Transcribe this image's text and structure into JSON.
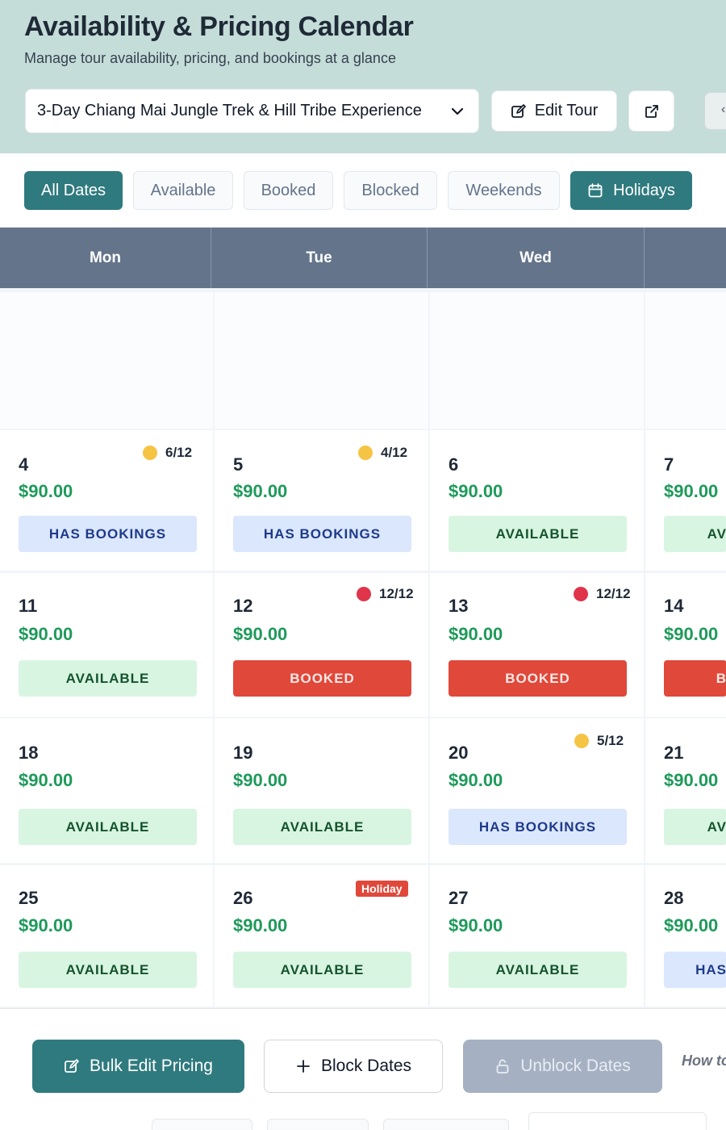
{
  "header": {
    "title": "Availability & Pricing Calendar",
    "subtitle": "Manage tour availability, pricing, and bookings at a glance",
    "tour_select_value": "3-Day Chiang Mai Jungle Trek & Hill Tribe Experience",
    "edit_tour_label": "Edit Tour",
    "partial_button_glyph": "‹"
  },
  "filters": [
    "All Dates",
    "Available",
    "Booked",
    "Blocked",
    "Weekends",
    "Holidays"
  ],
  "active_filter": "All Dates",
  "weekdays": [
    "Mon",
    "Tue",
    "Wed"
  ],
  "weeks": [
    [
      {
        "day": "4",
        "price": "$90.00",
        "status": "HAS BOOKINGS",
        "capacity": "6/12"
      },
      {
        "day": "5",
        "price": "$90.00",
        "status": "HAS BOOKINGS",
        "capacity": "4/12"
      },
      {
        "day": "6",
        "price": "$90.00",
        "status": "AVAILABLE"
      },
      {
        "day": "7",
        "price": "$90.00",
        "status": "AV"
      }
    ],
    [
      {
        "day": "11",
        "price": "$90.00",
        "status": "AVAILABLE"
      },
      {
        "day": "12",
        "price": "$90.00",
        "status": "BOOKED",
        "capacity": "12/12"
      },
      {
        "day": "13",
        "price": "$90.00",
        "status": "BOOKED",
        "capacity": "12/12"
      },
      {
        "day": "14",
        "price": "$90.00",
        "status": "B"
      }
    ],
    [
      {
        "day": "18",
        "price": "$90.00",
        "status": "AVAILABLE"
      },
      {
        "day": "19",
        "price": "$90.00",
        "status": "AVAILABLE"
      },
      {
        "day": "20",
        "price": "$90.00",
        "status": "HAS BOOKINGS",
        "capacity": "5/12"
      },
      {
        "day": "21",
        "price": "$90.00",
        "status": "AV"
      }
    ],
    [
      {
        "day": "25",
        "price": "$90.00",
        "status": "AVAILABLE"
      },
      {
        "day": "26",
        "price": "$90.00",
        "status": "AVAILABLE",
        "tag": "Holiday"
      },
      {
        "day": "27",
        "price": "$90.00",
        "status": "AVAILABLE"
      },
      {
        "day": "28",
        "price": "$90.00",
        "status": "HAS"
      }
    ]
  ],
  "actions": {
    "bulk_edit": "Bulk Edit Pricing",
    "block": "Block Dates",
    "unblock": "Unblock Dates",
    "help": "How to"
  },
  "colors": {
    "primary": "#2f7a7e",
    "available": "#d8f5e1",
    "has_bookings": "#dbe7fd",
    "booked": "#e0483a",
    "price": "#1e9a5a"
  }
}
